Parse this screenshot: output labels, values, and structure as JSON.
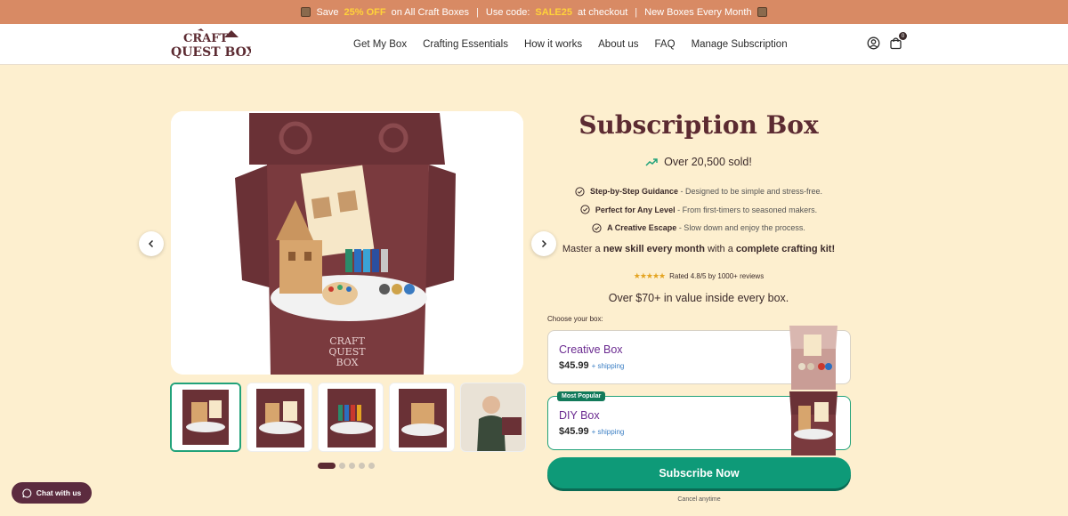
{
  "promo": {
    "save": "Save",
    "discount": "25% OFF",
    "on_text": "on All Craft Boxes",
    "sep1": "|",
    "code_label": "Use code:",
    "code": "SALE25",
    "checkout": "at checkout",
    "sep2": "|",
    "new_boxes": "New Boxes Every Month"
  },
  "logo": {
    "line1": "CRAFT",
    "line2": "QUEST BOX"
  },
  "nav": [
    {
      "label": "Get My Box"
    },
    {
      "label": "Crafting Essentials"
    },
    {
      "label": "How it works"
    },
    {
      "label": "About us"
    },
    {
      "label": "FAQ"
    },
    {
      "label": "Manage Subscription"
    }
  ],
  "cart": {
    "count": "0"
  },
  "product": {
    "title": "Subscription Box",
    "sold": "Over 20,500 sold!",
    "features": [
      {
        "title": "Step-by-Step Guidance",
        "desc": " - Designed to be simple and stress-free."
      },
      {
        "title": "Perfect for Any Level",
        "desc": " - From first-timers to seasoned makers."
      },
      {
        "title": "A Creative Escape",
        "desc": " - Slow down and enjoy the process."
      }
    ],
    "master": {
      "pre": "Master a ",
      "b1": "new skill every month",
      "mid": " with a ",
      "b2": "complete crafting kit!"
    },
    "rating_stars": "★★★★★",
    "rating_text": "Rated 4.8/5 by 1000+ reviews",
    "value": "Over $70+ in value inside every box.",
    "choose_label": "Choose your box:",
    "options": [
      {
        "name": "Creative Box",
        "price": "$45.99",
        "shipping": "+ shipping",
        "badge": ""
      },
      {
        "name": "DIY Box",
        "price": "$45.99",
        "shipping": "+ shipping",
        "badge": "Most Popular"
      }
    ],
    "subscribe": "Subscribe Now",
    "cancel": "Cancel anytime"
  },
  "chat": {
    "label": "Chat with us"
  },
  "gallery": {
    "slide_count": 5,
    "active_index": 0
  },
  "colors": {
    "brand": "#5c2b32",
    "accent": "#0e9a78",
    "promo_bg": "#d88a64",
    "page_bg": "#fdefcf"
  }
}
